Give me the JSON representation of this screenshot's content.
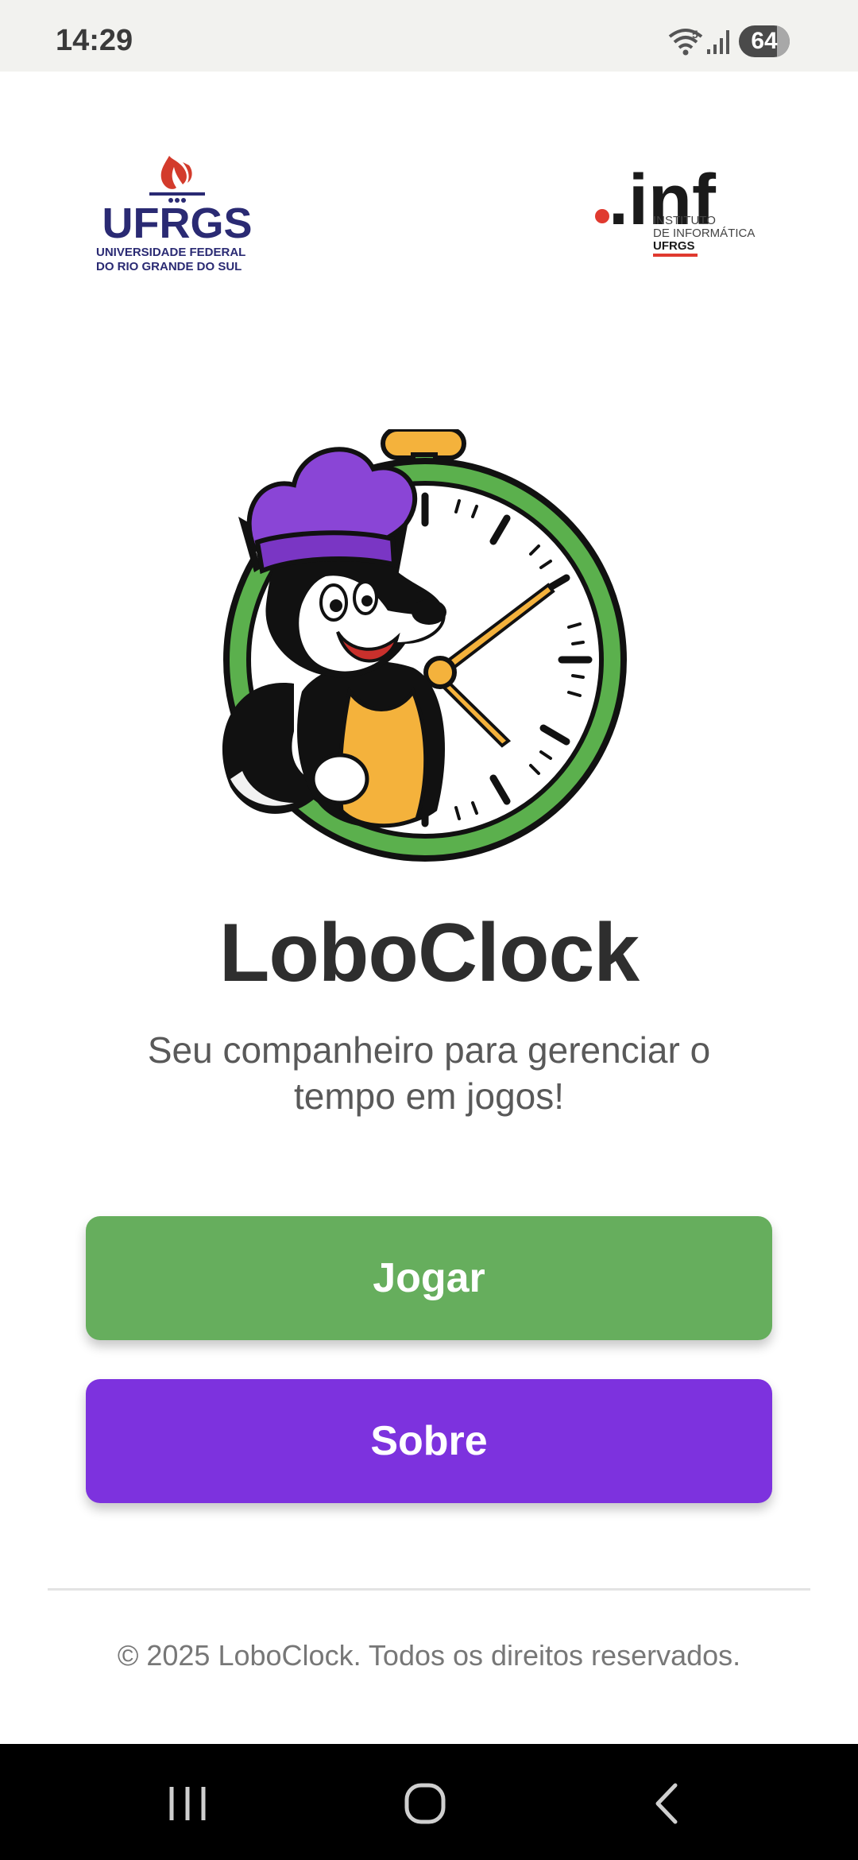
{
  "status_bar": {
    "time": "14:29",
    "wifi_badge": "5",
    "battery": "64",
    "icons": [
      "wifi-icon",
      "signal-icon",
      "battery-icon"
    ]
  },
  "logos": {
    "ufrgs": {
      "name": "UFRGS",
      "line1": "UNIVERSIDADE FEDERAL",
      "line2": "DO RIO GRANDE DO SUL"
    },
    "inf": {
      "name": ".inf",
      "line1": "INSTITUTO",
      "line2": "DE INFORMÁTICA",
      "line3": "UFRGS"
    }
  },
  "main": {
    "title": "LoboClock",
    "tagline": "Seu companheiro para gerenciar o tempo em jogos!",
    "buttons": {
      "play": "Jogar",
      "about": "Sobre"
    }
  },
  "footer": {
    "copyright": "© 2025 LoboClock. Todos os direitos reservados."
  },
  "nav_bar": {
    "icons": [
      "recents-icon",
      "home-icon",
      "back-icon"
    ]
  },
  "colors": {
    "play_button": "#66ae5d",
    "about_button": "#7d32de",
    "ufrgs_navy": "#2a2a73",
    "ufrgs_red": "#d33b2c",
    "inf_red": "#e03a2f",
    "clock_green": "#5bb04d",
    "chef_hat_purple": "#8a45d6"
  }
}
